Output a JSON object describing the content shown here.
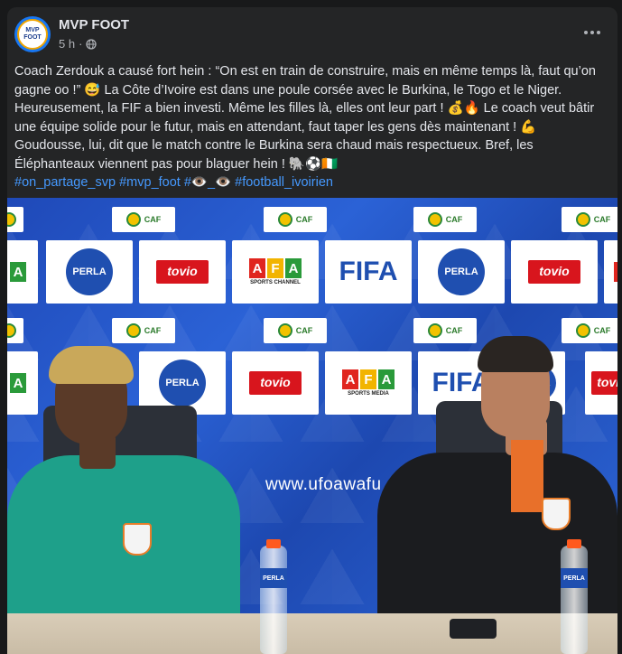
{
  "post": {
    "page_name": "MVP FOOT",
    "avatar_text": "MVP FOOT",
    "time": "5 h",
    "separator": "·",
    "text": "Coach Zerdouk a causé fort hein : “On est en train de construire, mais en même temps là, faut qu’on gagne oo !” 😅 La Côte d’Ivoire est dans une poule corsée avec le Burkina, le Togo et le Niger. Heureusement, la FIF a bien investi. Même les filles là, elles ont leur part ! 💰🔥 Le coach veut bâtir une équipe solide pour le futur, mais en attendant, faut taper les gens dès maintenant ! 💪 Goudousse, lui, dit que le match contre le Burkina sera chaud mais respectueux. Bref, les Éléphanteaux viennent pas pour blaguer hein ! 🐘⚽🇨🇮",
    "hashtags": [
      "#on_partage_svp",
      "#mvp_foot",
      "#👁️_👁️",
      "#football_ivoirien"
    ]
  },
  "photo": {
    "sponsors": {
      "perla": "PERLA",
      "tovio": "tovio",
      "afa": [
        "A",
        "F",
        "A"
      ],
      "afa_sub_1": "SPORTS CHANNEL",
      "afa_sub_2": "SPORTS MEDIA",
      "fifa": "FIFA",
      "caf": "CAF"
    },
    "url_text": "www.ufoawafu",
    "bottle_label": "PERLA"
  },
  "colors": {
    "background": "#18191a",
    "card": "#242526",
    "hashtag": "#4599ff",
    "backdrop": "#2a4fa8"
  },
  "icons": {
    "globe": "globe-icon",
    "more": "more-options-icon"
  }
}
